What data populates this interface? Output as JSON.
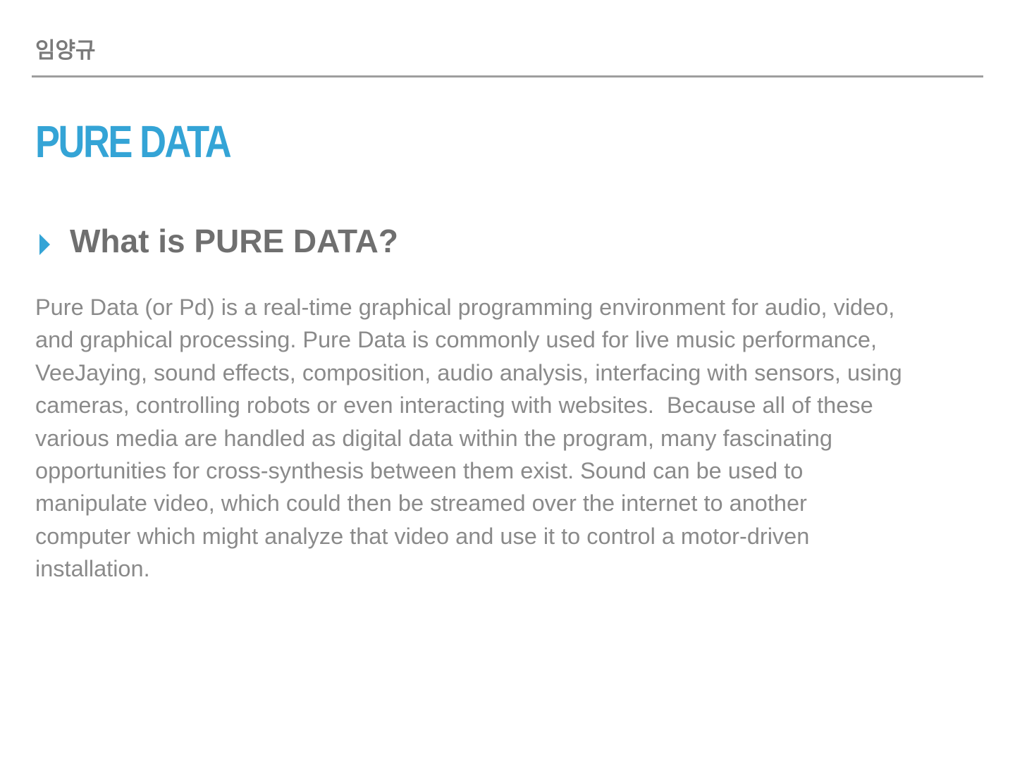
{
  "header": {
    "author": "임양규"
  },
  "slide": {
    "title": "PURE DATA",
    "bullet": {
      "icon": "triangle-right-bullet-icon",
      "text": "What is PURE DATA?"
    },
    "body_lines": [
      "Pure Data (or Pd) is a real-time graphical programming environment for audio, video,",
      "and graphical processing. Pure Data is commonly used for live music performance,",
      "VeeJaying, sound effects, composition, audio analysis, interfacing with sensors, using",
      "cameras, controlling robots or even interacting with websites.  Because all of these",
      "various media are handled as digital data within the program, many fascinating",
      "opportunities for cross-synthesis between them exist. Sound can be used to",
      "manipulate video, which could then be streamed over the internet to another",
      "computer which might analyze that video and use it to control a motor-driven",
      "installation."
    ]
  },
  "colors": {
    "accent": "#34a4d6",
    "heading": "#6f6f6f",
    "body": "#8a8a8a",
    "divider": "#9e9e9e"
  }
}
